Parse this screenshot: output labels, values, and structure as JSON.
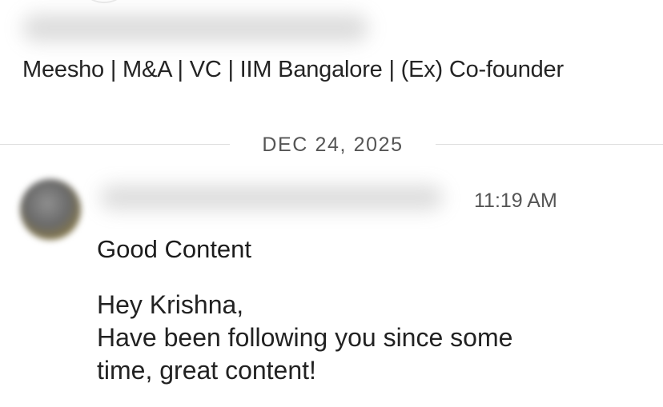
{
  "header": {
    "headline": "Meesho | M&A | VC | IIM Bangalore | (Ex) Co-founder"
  },
  "thread": {
    "date_separator": "DEC 24, 2025"
  },
  "message": {
    "timestamp": "11:19 AM",
    "subject": "Good Content",
    "body_lines": [
      "Hey Krishna,",
      "Have been following you since some",
      "time, great content!"
    ]
  }
}
